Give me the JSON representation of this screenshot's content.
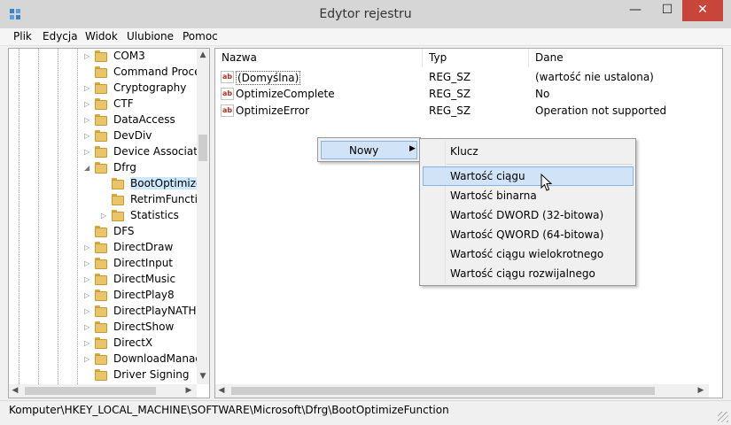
{
  "window": {
    "title": "Edytor rejestru",
    "controls": {
      "minimize": "—",
      "maximize": "☐",
      "close": "✕"
    },
    "close_color": "#c7453b"
  },
  "menu": [
    "Plik",
    "Edycja",
    "Widok",
    "Ulubione",
    "Pomoc"
  ],
  "tree": {
    "items": [
      {
        "label": "COM3",
        "expander": "▷"
      },
      {
        "label": "Command Proce",
        "expander": ""
      },
      {
        "label": "Cryptography",
        "expander": "▷"
      },
      {
        "label": "CTF",
        "expander": "▷"
      },
      {
        "label": "DataAccess",
        "expander": "▷"
      },
      {
        "label": "DevDiv",
        "expander": "▷"
      },
      {
        "label": "Device Associati",
        "expander": "▷"
      },
      {
        "label": "Dfrg",
        "expander": "◢"
      },
      {
        "label": "BootOptimize",
        "expander": ""
      },
      {
        "label": "RetrimFunctio",
        "expander": ""
      },
      {
        "label": "Statistics",
        "expander": "▷"
      },
      {
        "label": "DFS",
        "expander": ""
      },
      {
        "label": "DirectDraw",
        "expander": "▷"
      },
      {
        "label": "DirectInput",
        "expander": "▷"
      },
      {
        "label": "DirectMusic",
        "expander": "▷"
      },
      {
        "label": "DirectPlay8",
        "expander": "▷"
      },
      {
        "label": "DirectPlayNATHe",
        "expander": "▷"
      },
      {
        "label": "DirectShow",
        "expander": "▷"
      },
      {
        "label": "DirectX",
        "expander": "▷"
      },
      {
        "label": "DownloadManag",
        "expander": "▷"
      },
      {
        "label": "Driver Signing",
        "expander": ""
      }
    ],
    "selected_index": 8
  },
  "list": {
    "headers": {
      "name": "Nazwa",
      "type": "Typ",
      "data": "Dane"
    },
    "rows": [
      {
        "name": "(Domyślna)",
        "type": "REG_SZ",
        "data": "(wartość nie ustalona)",
        "icon": "ab"
      },
      {
        "name": "OptimizeComplete",
        "type": "REG_SZ",
        "data": "No",
        "icon": "ab"
      },
      {
        "name": "OptimizeError",
        "type": "REG_SZ",
        "data": "Operation not supported",
        "icon": "ab"
      }
    ]
  },
  "context_menu": {
    "parent_item": "Nowy",
    "submenu": [
      "Klucz",
      "Wartość ciągu",
      "Wartość binarna",
      "Wartość DWORD (32-bitowa)",
      "Wartość QWORD (64-bitowa)",
      "Wartość ciągu wielokrotnego",
      "Wartość ciągu rozwijalnego"
    ],
    "hover_index": 1
  },
  "status": {
    "path": "Komputer\\HKEY_LOCAL_MACHINE\\SOFTWARE\\Microsoft\\Dfrg\\BootOptimizeFunction"
  },
  "colors": {
    "selection": "#cce8ff",
    "menu_highlight": "#d1e3f6",
    "folder": "#e8c46a"
  }
}
